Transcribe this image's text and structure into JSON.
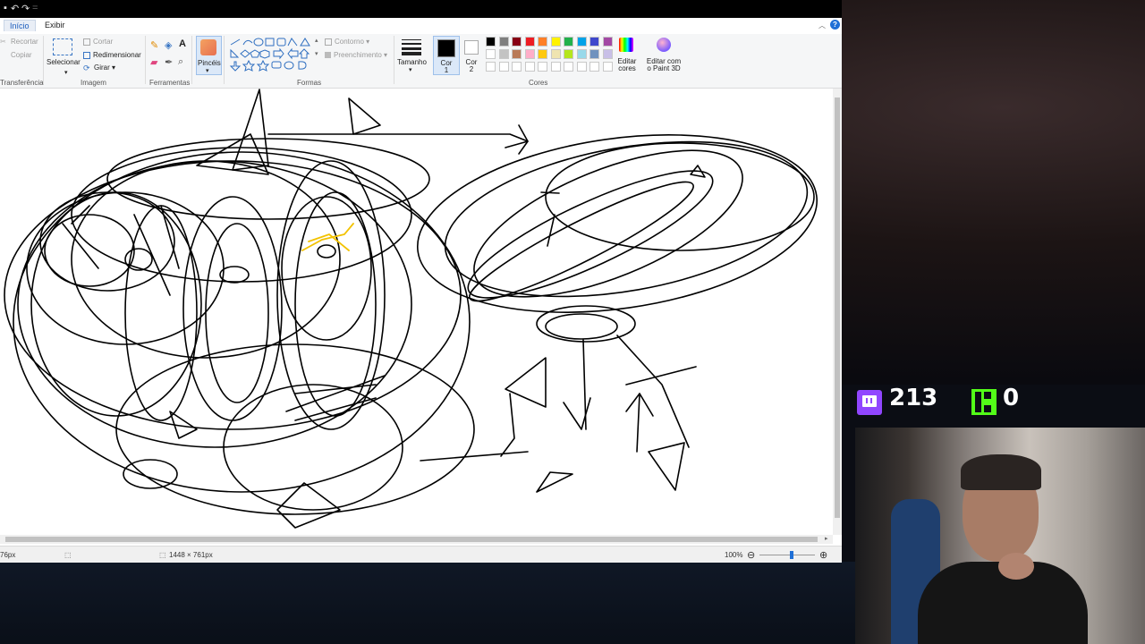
{
  "quick_access": [
    "↶",
    "↷",
    "="
  ],
  "tabs": [
    {
      "label": "Início",
      "active": true
    },
    {
      "label": "Exibir",
      "active": false
    }
  ],
  "ribbon": {
    "clipboard": {
      "cut": "Recortar",
      "copy": "Copiar",
      "group": "Transferência"
    },
    "image": {
      "select": "Selecionar",
      "crop": "Cortar",
      "resize": "Redimensionar",
      "rotate": "Girar",
      "group": "Imagem"
    },
    "tools": {
      "group": "Ferramentas",
      "text_tool": "A"
    },
    "brushes": {
      "label": "Pincéis"
    },
    "shapes": {
      "outline": "Contorno",
      "fill": "Preenchimento",
      "group": "Formas"
    },
    "size": {
      "label": "Tamanho"
    },
    "colors": {
      "color1": "Cor 1",
      "color2": "Cor 2",
      "group": "Cores",
      "edit": "Editar cores",
      "paint3d": "Editar com o Paint 3D",
      "row1": [
        "#000000",
        "#7f7f7f",
        "#880015",
        "#ed1c24",
        "#ff7f27",
        "#fff200",
        "#22b14c",
        "#00a2e8",
        "#3f48cc",
        "#a349a4"
      ],
      "row2": [
        "#ffffff",
        "#c3c3c3",
        "#b97a57",
        "#ffaec9",
        "#ffc90e",
        "#efe4b0",
        "#b5e61d",
        "#99d9ea",
        "#7092be",
        "#c8bfe7"
      ],
      "row3": [
        "#ffffff",
        "#ffffff",
        "#ffffff",
        "#ffffff",
        "#ffffff",
        "#ffffff",
        "#ffffff",
        "#ffffff",
        "#ffffff",
        "#ffffff"
      ]
    }
  },
  "statusbar": {
    "cursor_pos": "76px",
    "image_size": "1448 × 761px",
    "zoom": "100%",
    "zoom_level_fraction": 0.55
  },
  "overlay": {
    "twitch_count": "213",
    "kick_count": "0",
    "twitch_color": "#9146ff",
    "kick_color": "#53fc18"
  }
}
